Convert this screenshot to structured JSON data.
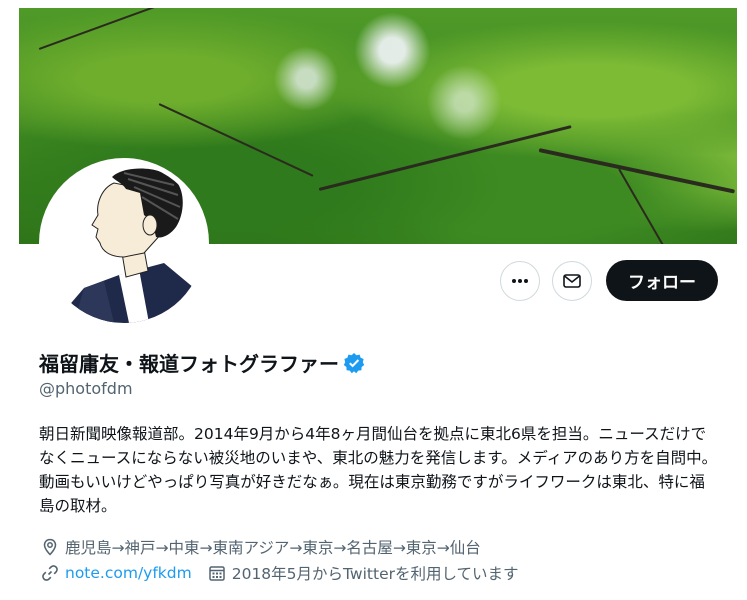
{
  "profile": {
    "display_name": "福留庸友・報道フォトグラファー",
    "handle": "@photofdm",
    "bio": "朝日新聞映像報道部。2014年9月から4年8ヶ月間仙台を拠点に東北6県を担当。ニュースだけでなくニュースにならない被災地のいまや、東北の魅力を発信します。メディアのあり方を自問中。動画もいいけどやっぱり写真が好きだなぁ。現在は東京勤務ですがライフワークは東北、特に福島の取材。",
    "location": "鹿児島→神戸→中東→東南アジア→東京→名古屋→東京→仙台",
    "website": "note.com/yfkdm",
    "joined": "2018年5月からTwitterを利用しています",
    "verified": true
  },
  "actions": {
    "more_icon": "more-dots-icon",
    "message_icon": "envelope-icon",
    "follow_label": "フォロー"
  },
  "colors": {
    "accent": "#1d9bf0",
    "text": "#0f1419",
    "muted": "#536471",
    "follow_bg": "#0f1419"
  }
}
